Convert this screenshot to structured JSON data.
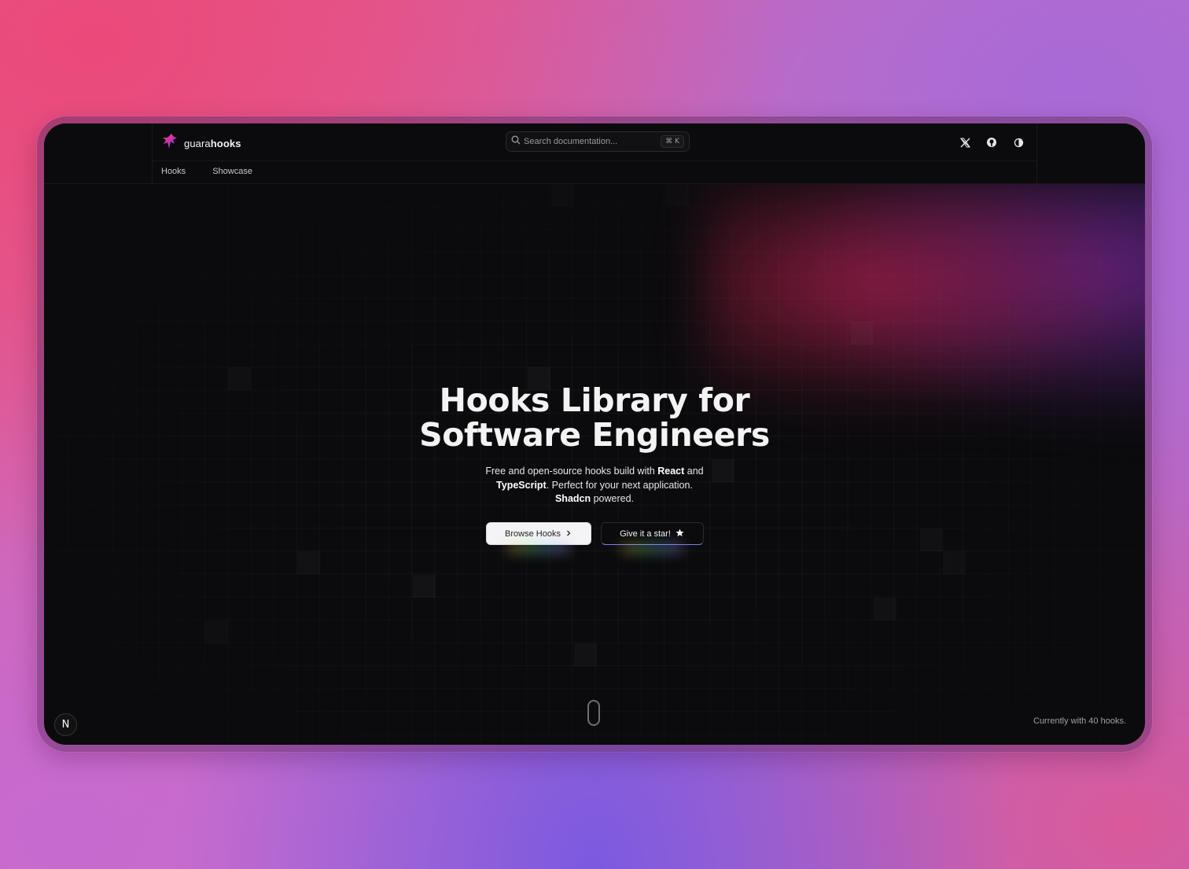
{
  "brand": {
    "name_prefix": "guara",
    "name_bold": "hooks"
  },
  "search": {
    "placeholder": "Search documentation...",
    "shortcut": "⌘ K"
  },
  "header_icons": [
    "x-twitter-icon",
    "github-icon",
    "theme-toggle-icon"
  ],
  "nav": {
    "items": [
      "Hooks",
      "Showcase"
    ]
  },
  "hero": {
    "title_line1": "Hooks Library for",
    "title_line2": "Software Engineers",
    "desc_part1": "Free and open-source hooks build with ",
    "desc_react": "React",
    "desc_and": " and ",
    "desc_ts": "TypeScript",
    "desc_part2": ". Perfect for your next application. ",
    "desc_shadcn": "Shadcn",
    "desc_part3": " powered."
  },
  "buttons": {
    "browse": "Browse Hooks",
    "star": "Give it a star!"
  },
  "footer": {
    "badge": "N",
    "count_text": "Currently with 40 hooks."
  },
  "colors": {
    "background_dark": "#0b0b0d",
    "accent_pink": "#e6578a",
    "accent_purple": "#9a6ce0"
  }
}
